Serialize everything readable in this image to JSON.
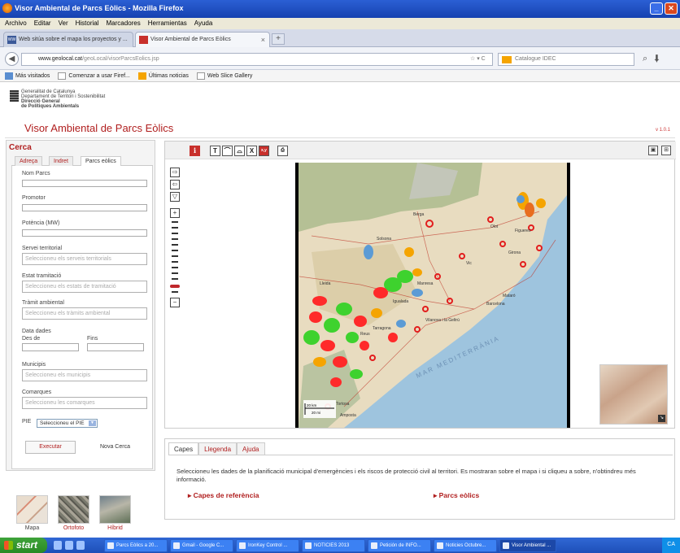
{
  "window": {
    "title": "Visor Ambiental de Parcs Eòlics - Mozilla Firefox"
  },
  "menu": [
    "Archivo",
    "Editar",
    "Ver",
    "Historial",
    "Marcadores",
    "Herramientas",
    "Ayuda"
  ],
  "tabs": [
    {
      "label": "Web sitúa sobre el mapa los proyectos y ..."
    },
    {
      "label": "Visor Ambiental de Parcs Eòlics"
    }
  ],
  "url": {
    "domain": "www.geolocal.cat",
    "path": "/geoLocal/visorParcsEolics.jsp"
  },
  "search": {
    "placeholder": "Catalogue IDEC"
  },
  "bookmarks": [
    "Más visitados",
    "Comenzar a usar Firef...",
    "Últimas noticias",
    "Web Slice Gallery"
  ],
  "org": {
    "line1": "Generalitat de Catalunya",
    "line2": "Departament de Territori i Sostenibilitat",
    "line3": "Direcció General",
    "line4": "de Polítiques Ambientals"
  },
  "app": {
    "title": "Visor Ambiental de Parcs Eòlics",
    "version": "v 1.0.1"
  },
  "cerca": {
    "title": "Cerca",
    "tabs": [
      "Adreça",
      "Indret",
      "Parcs eòlics"
    ],
    "fields": {
      "nom": "Nom Parcs",
      "promotor": "Promotor",
      "potencia": "Potència (MW)",
      "servei": "Servei territorial",
      "servei_ph": "Seleccioneu els serveis territorials",
      "estat": "Estat tramitació",
      "estat_ph": "Seleccioneu els estats de tramitació",
      "tramit": "Tràmit ambiental",
      "tramit_ph": "Seleccioneu els tràmits ambiental",
      "data": "Data dades",
      "des": "Des de",
      "fins": "Fins",
      "municipis": "Municipis",
      "municipis_ph": "Seleccioneu els municipis",
      "comarques": "Comarques",
      "comarques_ph": "Seleccioneu les comarques",
      "pie": "PIE",
      "pie_value": "Seleccioneu el PIE"
    },
    "executar": "Executar",
    "nova": "Nova Cerca"
  },
  "basemaps": [
    "Mapa",
    "Ortofoto",
    "Híbrid"
  ],
  "map": {
    "tools": [
      "T",
      "X",
      "x,y"
    ],
    "scale1": "20 km",
    "scale2": "20 mi",
    "labels": [
      "Barcelona",
      "Tarragona",
      "Girona",
      "Vilanova i la Geltrú",
      "Manresa",
      "Vic",
      "Figueres",
      "Lleida",
      "MAR MEDITERRÀNIA",
      "Reus",
      "Tortosa",
      "Amposta",
      "Igualada",
      "Berga",
      "Olot",
      "Solsona",
      "Mataró"
    ]
  },
  "bottom": {
    "tabs": [
      "Capes",
      "Llegenda",
      "Ajuda"
    ],
    "text": "Seleccioneu les dades de la planificació municipal d'emergències i els riscos de protecció civil al territori. Es mostraran sobre el mapa i si cliqueu a sobre, n'obtindreu més informació.",
    "link1": "▸ Capes de referència",
    "link2": "▸ Parcs eòlics"
  },
  "taskbar": {
    "start": "start",
    "items": [
      "Parcs Eòlics a 20...",
      "Gmail - Google C...",
      "IronKey Control ...",
      "NOTICIES 2013",
      "Petición de INFO...",
      "Noticies Octubre...",
      "Visor Ambiental ..."
    ],
    "tray": "CA"
  },
  "colors": {
    "accent": "#b01e1e",
    "titlebar": "#1e50c0",
    "taskbar": "#245ed0"
  }
}
